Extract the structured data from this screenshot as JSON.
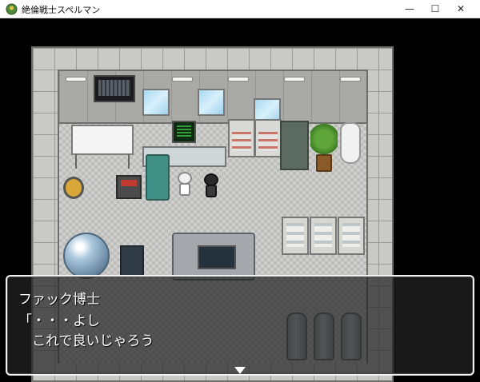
{
  "window": {
    "title": "絶倫戦士スペルマン",
    "minimize_glyph": "—",
    "maximize_glyph": "☐",
    "close_glyph": "✕",
    "icon": "game-app-icon"
  },
  "scene": {
    "location": "laboratory",
    "characters": [
      {
        "id": "dr-fack",
        "sprite": "white-haired-scientist"
      },
      {
        "id": "dark-figure",
        "sprite": "black-humanoid"
      }
    ]
  },
  "dialogue": {
    "speaker": "ファック博士",
    "lines": [
      "「・・・よし",
      "　これで良いじゃろう"
    ],
    "continue_indicator": "down-triangle"
  },
  "colors": {
    "dialogue_bg": "#222224",
    "dialogue_border": "#f2f2f2",
    "floor": "#bdbdbb",
    "wall": "#a9a9a5"
  }
}
